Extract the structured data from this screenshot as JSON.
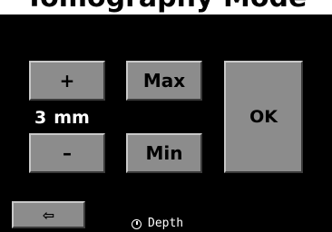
{
  "title": "Tomography Mode",
  "buttons": {
    "increase": "+",
    "decrease": "–",
    "max": "Max",
    "min": "Min",
    "ok": "OK",
    "back": "⇦"
  },
  "value": {
    "number": "3",
    "unit": "mm"
  },
  "status": {
    "label": "Depth",
    "icon": "depth-gauge-icon"
  },
  "colors": {
    "background": "#000000",
    "button_face": "#8c8c8c",
    "text_on_dark": "#ffffff"
  }
}
